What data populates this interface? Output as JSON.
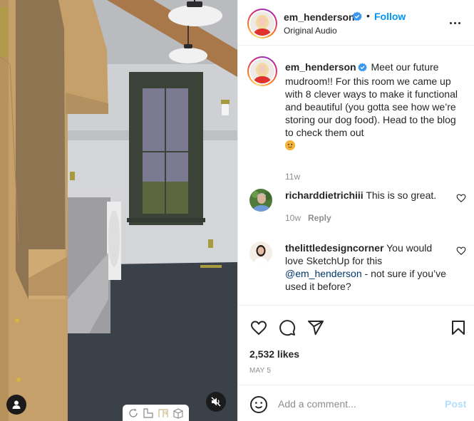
{
  "media": {
    "type": "video",
    "description": "3D SketchUp render of a mudroom: wood cabinets, window, laundry machine, pendant lights",
    "controls": {
      "tag_icon": "user-tag-icon",
      "mute_icon": "speaker-muted-icon",
      "viewer_toolbar": [
        "orbit-icon",
        "floor-plan-icon",
        "elevation-icon",
        "3d-view-icon"
      ]
    }
  },
  "header": {
    "username": "em_henderson",
    "verified": true,
    "separator": "•",
    "follow_label": "Follow",
    "audio_label": "Original Audio",
    "more_icon": "more-horizontal-icon"
  },
  "caption": {
    "username": "em_henderson",
    "text": "Meet our future mudroom!! For this room we came up with 8 clever ways to make it functional and beautiful (you gotta see how we’re storing our dog food). Head to the blog to check them out",
    "emoji": "🙂",
    "time": "11w"
  },
  "comments": [
    {
      "username": "richarddietrichiii",
      "text": "This is so great.",
      "time": "10w",
      "reply_label": "Reply"
    },
    {
      "username": "thelittledesigncorner",
      "text_before": "You would love SketchUp for this ",
      "mention": "@em_henderson",
      "text_after": " - not sure if you’ve used it before?"
    }
  ],
  "actions": {
    "like_icon": "heart-icon",
    "comment_icon": "comment-icon",
    "share_icon": "send-icon",
    "save_icon": "bookmark-icon",
    "likes": "2,532 likes",
    "date": "MAY 5"
  },
  "add_comment": {
    "placeholder": "Add a comment...",
    "value": "",
    "post_label": "Post"
  },
  "colors": {
    "link_blue": "#0095f6",
    "post_disabled": "#b2dffc",
    "mention": "#00376b",
    "verified": "#3897f0",
    "muted_text": "#8e8e8e"
  }
}
